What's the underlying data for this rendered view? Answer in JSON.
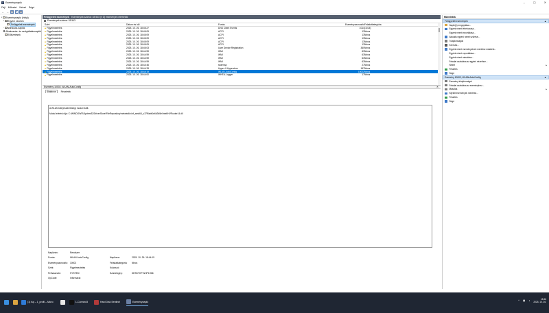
{
  "window": {
    "title": "Eseménynapló",
    "controls": [
      "–",
      "▢",
      "✕"
    ]
  },
  "menu": [
    "Fájl",
    "Művelet",
    "Nézet",
    "Súgó"
  ],
  "toolbar": {
    "back": "←",
    "forward": "→",
    "btn3": "▤",
    "btn4": "?",
    "btn5": "▦"
  },
  "tree": [
    {
      "label": "Eseménynapló (Helyi)",
      "twisty": "▾",
      "indent": 0,
      "selected": false
    },
    {
      "label": "Egyéni nézetek",
      "twisty": "▾",
      "indent": 1,
      "selected": false
    },
    {
      "label": "Felügyeleti események",
      "twisty": "",
      "indent": 2,
      "selected": true
    },
    {
      "label": "Windows-naplók",
      "twisty": "›",
      "indent": 1,
      "selected": false
    },
    {
      "label": "Alkalmazás- és szolgáltatásnaplók",
      "twisty": "›",
      "indent": 1,
      "selected": false
    },
    {
      "label": "Előfizetések",
      "twisty": "",
      "indent": 1,
      "selected": false
    }
  ],
  "main": {
    "section_title": "Felügyeleti események",
    "section_count": "Események száma: 18 543 (!) Új események elérhetők",
    "filter_text": "Események száma: 18 543",
    "columns": {
      "szint": "Szint",
      "datum": "Dátum és idő",
      "forras": "Forrás",
      "azon": "Eseményazonosító",
      "kat": "Feladatkategória"
    },
    "rows": [
      {
        "szint": "Figyelmeztetés",
        "datum": "2025. 10. 26. 18:45:27",
        "forras": "DNS Client Events",
        "azon": "1014",
        "kat": "(1014)"
      },
      {
        "szint": "Figyelmeztetés",
        "datum": "2025. 10. 26. 18:45:09",
        "forras": "ACPI",
        "azon": "13",
        "kat": "Nincs"
      },
      {
        "szint": "Figyelmeztetés",
        "datum": "2025. 10. 26. 18:45:09",
        "forras": "ACPI",
        "azon": "13",
        "kat": "Nincs"
      },
      {
        "szint": "Figyelmeztetés",
        "datum": "2025. 10. 26. 18:45:09",
        "forras": "ACPI",
        "azon": "13",
        "kat": "Nincs"
      },
      {
        "szint": "Figyelmeztetés",
        "datum": "2025. 10. 26. 18:45:09",
        "forras": "ACPI",
        "azon": "13",
        "kat": "Nincs"
      },
      {
        "szint": "Figyelmeztetés",
        "datum": "2025. 10. 26. 18:45:09",
        "forras": "ACPI",
        "azon": "13",
        "kat": "Nincs"
      },
      {
        "szint": "Figyelmeztetés",
        "datum": "2025. 10. 26. 18:45:03",
        "forras": "User Device Registration",
        "azon": "360",
        "kat": "Nincs"
      },
      {
        "szint": "Figyelmeztetés",
        "datum": "2025. 10. 26. 18:44:59",
        "forras": "WMI",
        "azon": "63",
        "kat": "Nincs"
      },
      {
        "szint": "Figyelmeztetés",
        "datum": "2025. 10. 26. 18:44:59",
        "forras": "WMI",
        "azon": "63",
        "kat": "Nincs"
      },
      {
        "szint": "Figyelmeztetés",
        "datum": "2025. 10. 26. 18:44:59",
        "forras": "WMI",
        "azon": "63",
        "kat": "Nincs"
      },
      {
        "szint": "Figyelmeztetés",
        "datum": "2025. 10. 26. 18:44:59",
        "forras": "WMI",
        "azon": "63",
        "kat": "Nincs"
      },
      {
        "szint": "Figyelmeztetés",
        "datum": "2025. 10. 26. 18:44:46",
        "forras": "stornvsp",
        "azon": "27",
        "kat": "Nincs"
      },
      {
        "szint": "Figyelmeztetés",
        "datum": "2025. 10. 26. 18:44:33",
        "forras": "Hyper-V-Hypervisor",
        "azon": "167",
        "kat": "Nincs"
      },
      {
        "szint": "Figyelmeztetés",
        "datum": "2025. 10. 26. 18:44:19",
        "forras": "WLAN-AutoConfig",
        "azon": "10002",
        "kat": "Nincs"
      },
      {
        "szint": "Figyelmeztetés",
        "datum": "2025. 10. 26. 18:44:00",
        "forras": "WHEA-Logger",
        "azon": "17",
        "kat": "Nincs"
      }
    ],
    "selected_index": 13
  },
  "detail": {
    "title": "Esemény 10002, WLAN-AutoConfig",
    "close": "✕",
    "tabs": [
      "Általános",
      "Részletek"
    ],
    "message_1": "A WLAN kiterjeszthetőségi modul leállt.",
    "message_2": "Modul elérési útja: C:\\WINDOWS\\System32\\DriverStore\\FileRepository\\netwtw6e.inf_amd64_c37f5abf1e6d3b5e\\IntelIHVRouter14.dll",
    "props": [
      {
        "l1": "Naplónév:",
        "v1": "Rendszer",
        "l2": "",
        "v2": ""
      },
      {
        "l1": "Forrás:",
        "v1": "WLAN-AutoConfig",
        "l2": "Naplózva:",
        "v2": "2025. 10. 26. 18:44:19"
      },
      {
        "l1": "Eseményazonosító:",
        "v1": "10002",
        "l2": "Feladatkategória:",
        "v2": "Nincs"
      },
      {
        "l1": "Szint:",
        "v1": "Figyelmeztetés",
        "l2": "Kulcsszó:",
        "v2": ""
      },
      {
        "l1": "Felhasználó:",
        "v1": "SYSTEM",
        "l2": "Számítógép:",
        "v2": "DESKTOP-NHP1H66"
      },
      {
        "l1": "OpCode:",
        "v1": "Információ",
        "l2": "",
        "v2": ""
      }
    ]
  },
  "actions": {
    "title": "Műveletek",
    "sec1": "Felügyeleti események",
    "sec1_items": [
      {
        "label": "Napló(k) megnyitása...",
        "icon": "folder",
        "arrow": ""
      },
      {
        "label": "Egyéni nézet létrehozása...",
        "icon": "filter",
        "arrow": ""
      },
      {
        "label": "Egyéni nézet importálása...",
        "icon": "",
        "arrow": ""
      },
      {
        "label": "Aktuális egyéni nézet szűrése...",
        "icon": "filter",
        "arrow": ""
      },
      {
        "label": "Tulajdonságok",
        "icon": "props",
        "arrow": ""
      },
      {
        "label": "Keresés...",
        "icon": "find",
        "arrow": ""
      },
      {
        "label": "Egyéni nézet eseményeinek mentése másként...",
        "icon": "save",
        "arrow": ""
      },
      {
        "label": "Egyéni nézet exportálása...",
        "icon": "",
        "arrow": ""
      },
      {
        "label": "Egyéni nézet másolása...",
        "icon": "",
        "arrow": ""
      },
      {
        "label": "Feladat csatolása az egyéni nézethez...",
        "icon": "",
        "arrow": ""
      },
      {
        "label": "Nézet",
        "icon": "",
        "arrow": "▸"
      },
      {
        "label": "Frissítés",
        "icon": "refresh",
        "arrow": ""
      },
      {
        "label": "Súgó",
        "icon": "help",
        "arrow": ""
      }
    ],
    "sec2": "Esemény 10002, WLAN-AutoConfig",
    "sec2_items": [
      {
        "label": "Esemény tulajdonságai",
        "icon": "props",
        "arrow": ""
      },
      {
        "label": "Feladat csatolása az eseményhez...",
        "icon": "task",
        "arrow": ""
      },
      {
        "label": "Másolás",
        "icon": "copy",
        "arrow": "▸"
      },
      {
        "label": "Kijelölt események mentése...",
        "icon": "save",
        "arrow": ""
      },
      {
        "label": "Frissítés",
        "icon": "refresh",
        "arrow": ""
      },
      {
        "label": "Súgó",
        "icon": "help",
        "arrow": ""
      }
    ]
  },
  "taskbar": {
    "items": [
      {
        "label": "",
        "color": "#3a8fe0"
      },
      {
        "label": "",
        "color": "#d9a441"
      },
      {
        "label": "(1) lsp – 1_profil – Micro",
        "color": "#2f7bd6"
      },
      {
        "label": "",
        "color": "#e8e8e8"
      },
      {
        "label": "L-Connect3",
        "color": "#111111"
      },
      {
        "label": "Hard Disk Sentinel",
        "color": "#b03a3a"
      },
      {
        "label": "Eseménynapló",
        "color": "#6a7fa3"
      }
    ],
    "tray_chevron": "^",
    "time": "18:46",
    "date": "2025. 10. 26."
  }
}
